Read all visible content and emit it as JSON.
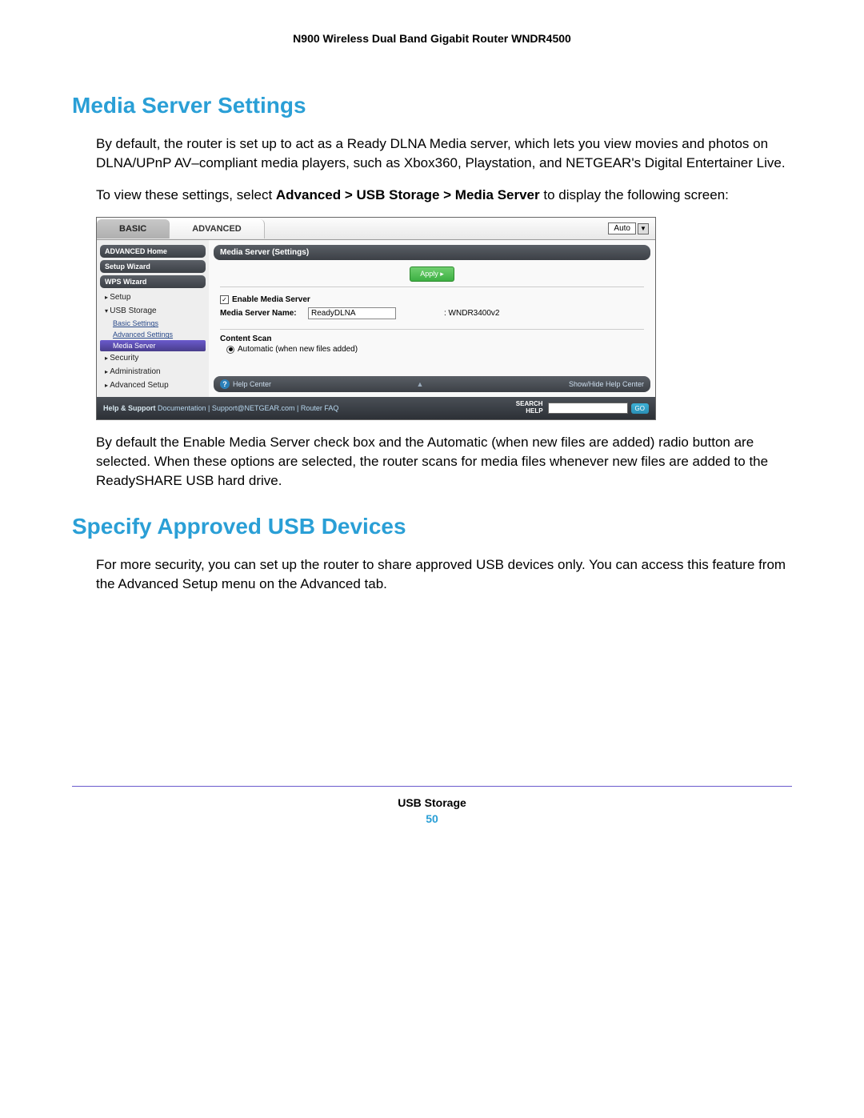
{
  "header": {
    "title": "N900 Wireless Dual Band Gigabit Router WNDR4500"
  },
  "section1": {
    "title": "Media Server Settings",
    "para1": "By default, the router is set up to act as a Ready DLNA Media server, which lets you view movies and photos on DLNA/UPnP AV–compliant media players, such as Xbox360, Playstation, and NETGEAR's Digital Entertainer Live.",
    "para2_pre": "To view these settings, select ",
    "para2_bold": "Advanced > USB Storage > Media Server",
    "para2_post": " to display the following screen:",
    "para_after": "By default the Enable Media Server check box and the Automatic (when new files are added) radio button are selected. When these options are selected, the router scans for media files whenever new files are added to the ReadySHARE USB hard drive."
  },
  "section2": {
    "title": "Specify Approved USB Devices",
    "para1": "For more security, you can set up the router to share approved USB devices only. You can access this feature from the Advanced Setup menu on the Advanced tab."
  },
  "screenshot": {
    "tabs": {
      "basic": "BASIC",
      "advanced": "ADVANCED",
      "auto": "Auto"
    },
    "sidebar": {
      "home": "ADVANCED Home",
      "setup_wizard": "Setup Wizard",
      "wps_wizard": "WPS Wizard",
      "setup": "Setup",
      "usb_storage": "USB Storage",
      "basic_settings": "Basic Settings",
      "advanced_settings": "Advanced Settings",
      "media_server": "Media Server",
      "security": "Security",
      "administration": "Administration",
      "advanced_setup": "Advanced Setup"
    },
    "panel": {
      "title": "Media Server (Settings)",
      "apply": "Apply ▸",
      "enable_label": "Enable Media Server",
      "name_label": "Media Server Name:",
      "name_value": "ReadyDLNA",
      "name_suffix": ": WNDR3400v2",
      "scan_header": "Content Scan",
      "scan_option": "Automatic (when new files added)"
    },
    "helpbar": {
      "label": "Help Center",
      "toggle": "Show/Hide Help Center"
    },
    "footer": {
      "prefix": "Help & Support",
      "links": "Documentation  |  Support@NETGEAR.com  |  Router FAQ",
      "search_label1": "SEARCH",
      "search_label2": "HELP",
      "go": "GO"
    }
  },
  "page_footer": {
    "chapter": "USB Storage",
    "page_number": "50"
  }
}
